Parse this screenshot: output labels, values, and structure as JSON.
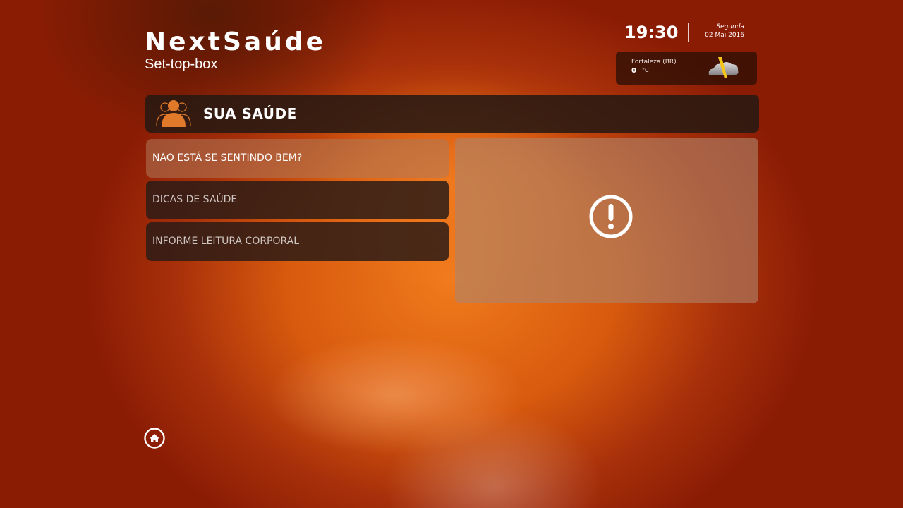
{
  "brand": {
    "title": "NextSaúde",
    "subtitle": "Set-top-box"
  },
  "clock": {
    "time": "19:30",
    "weekday": "Segunda",
    "date": "02 Mai 2016"
  },
  "weather": {
    "city": "Fortaleza (BR)",
    "temperature": "0",
    "unit": "°C",
    "icon": "storm-cloud-icon"
  },
  "section": {
    "title": "SUA SAÚDE",
    "icon": "people-icon"
  },
  "menu": {
    "items": [
      {
        "label": "NÃO ESTÁ SE SENTINDO BEM?",
        "selected": true
      },
      {
        "label": "DICAS DE SAÚDE",
        "selected": false
      },
      {
        "label": "INFORME LEITURA CORPORAL",
        "selected": false
      }
    ]
  },
  "preview": {
    "icon": "alert-icon"
  },
  "footer": {
    "home_icon": "home-icon"
  },
  "colors": {
    "background": "#d85a0e",
    "panel": "#2d1c16",
    "accent": "#e07a2a"
  }
}
